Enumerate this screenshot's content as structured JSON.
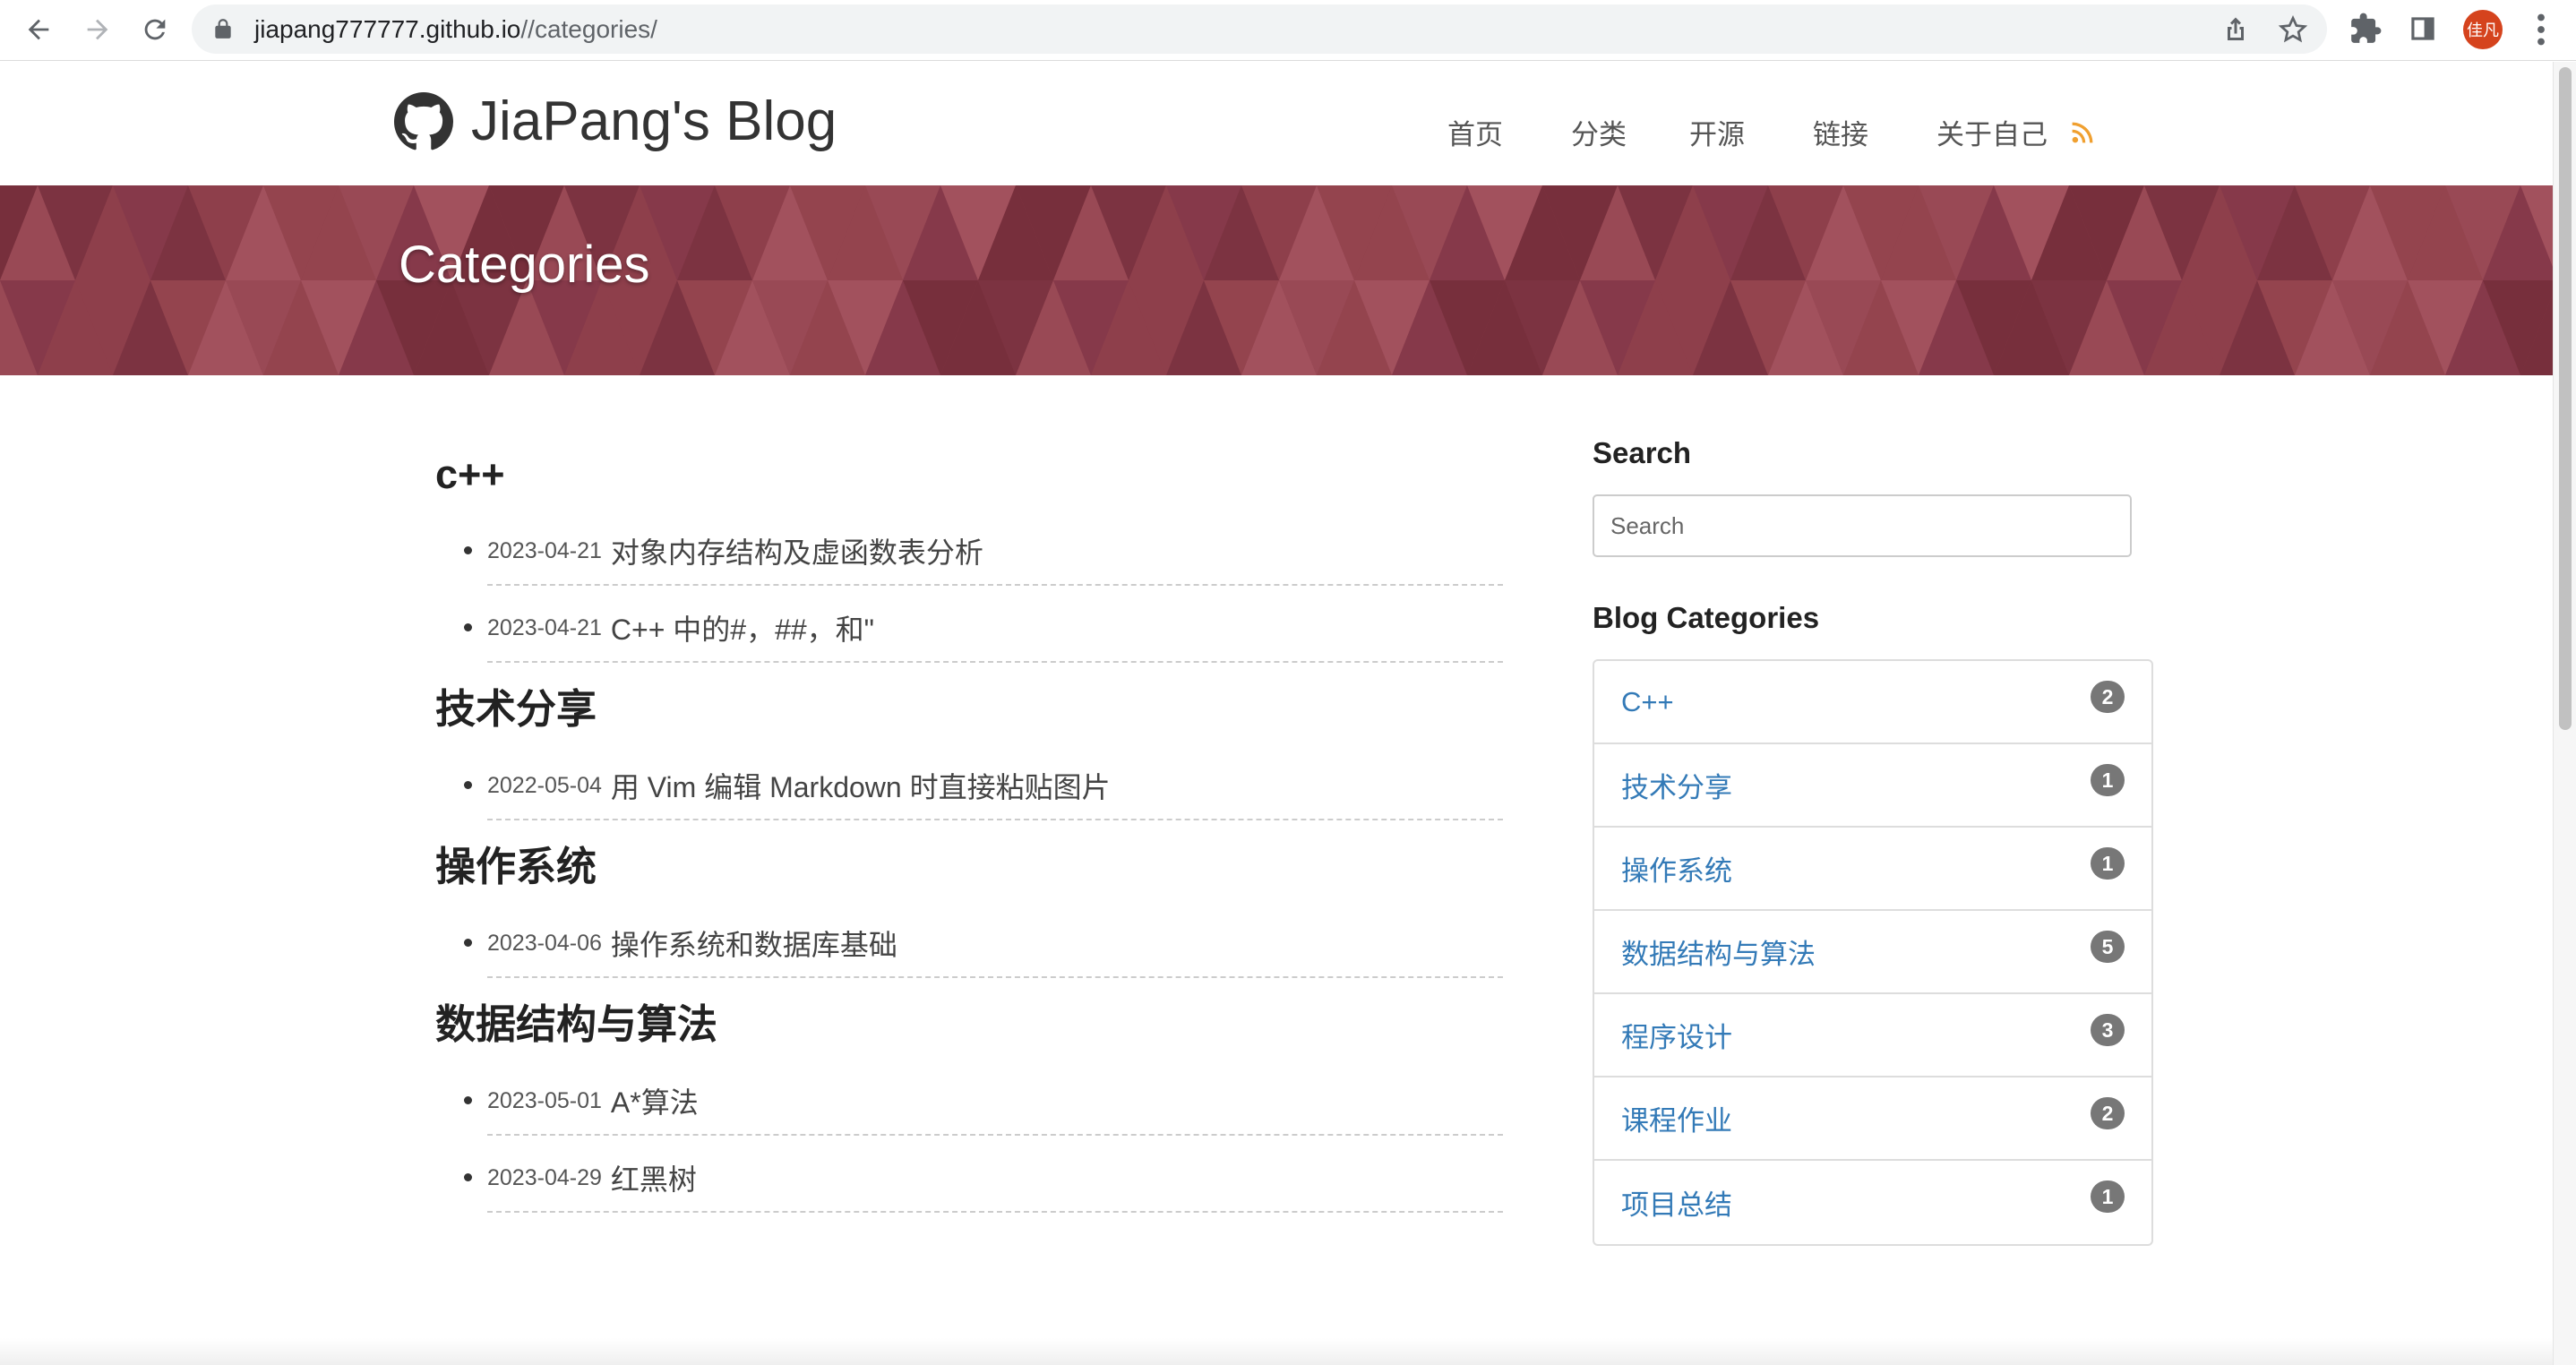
{
  "browser": {
    "url_host": "jiapang777777.github.io",
    "url_path": "//categories/",
    "profile_initials": "佳凡"
  },
  "site": {
    "brand": "JiaPang's Blog",
    "menu": [
      {
        "label": "首页"
      },
      {
        "label": "分类"
      },
      {
        "label": "开源"
      },
      {
        "label": "链接"
      },
      {
        "label": "关于自己"
      }
    ],
    "banner_title": "Categories"
  },
  "categories": [
    {
      "name": "c++",
      "posts": [
        {
          "date": "2023-04-21",
          "title": "对象内存结构及虚函数表分析"
        },
        {
          "date": "2023-04-21",
          "title": "C++ 中的#，##，和\""
        }
      ]
    },
    {
      "name": "技术分享",
      "posts": [
        {
          "date": "2022-05-04",
          "title": "用 Vim 编辑 Markdown 时直接粘贴图片"
        }
      ]
    },
    {
      "name": "操作系统",
      "posts": [
        {
          "date": "2023-04-06",
          "title": "操作系统和数据库基础"
        }
      ]
    },
    {
      "name": "数据结构与算法",
      "posts": [
        {
          "date": "2023-05-01",
          "title": "A*算法"
        },
        {
          "date": "2023-04-29",
          "title": "红黑树"
        }
      ]
    }
  ],
  "sidebar": {
    "search_heading": "Search",
    "search_placeholder": "Search",
    "categories_heading": "Blog Categories",
    "items": [
      {
        "label": "C++",
        "count": "2"
      },
      {
        "label": "技术分享",
        "count": "1"
      },
      {
        "label": "操作系统",
        "count": "1"
      },
      {
        "label": "数据结构与算法",
        "count": "5"
      },
      {
        "label": "程序设计",
        "count": "3"
      },
      {
        "label": "课程作业",
        "count": "2"
      },
      {
        "label": "项目总结",
        "count": "1"
      }
    ]
  },
  "colors": {
    "banner": "#8e3f4b",
    "link": "#337ab7",
    "badge": "#777777",
    "rss": "#f0a030"
  },
  "icons": [
    "back-icon",
    "forward-icon",
    "reload-icon",
    "lock-icon",
    "share-icon",
    "star-icon",
    "extensions-icon",
    "side-panel-icon",
    "github-icon",
    "rss-icon",
    "menu-kebab-icon"
  ]
}
